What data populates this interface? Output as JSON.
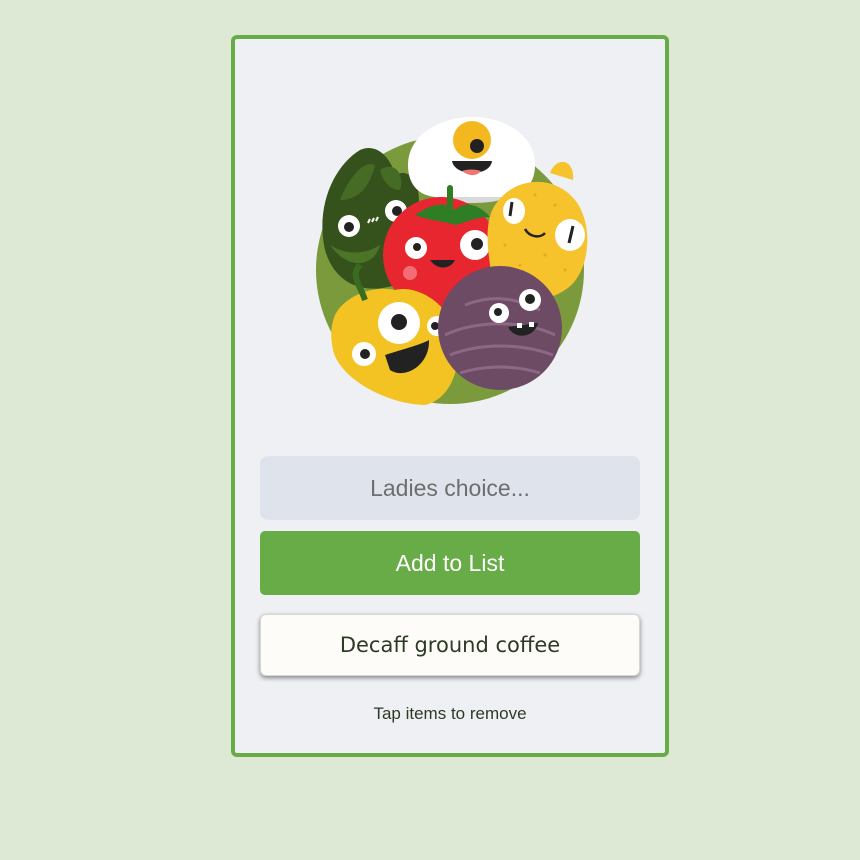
{
  "form": {
    "input_placeholder": "Ladies choice...",
    "input_value": "",
    "add_button_label": "Add to List"
  },
  "list": {
    "items": [
      {
        "label": "Decaff ground coffee"
      }
    ],
    "hint": "Tap items to remove"
  },
  "illustration": {
    "icon": "vegetable-characters-illustration"
  },
  "colors": {
    "accent": "#67ac46",
    "page_background": "#dde9d5",
    "card_background": "#eef0f4",
    "input_background": "#dfe3ec",
    "list_item_background": "#fdfcf8"
  }
}
